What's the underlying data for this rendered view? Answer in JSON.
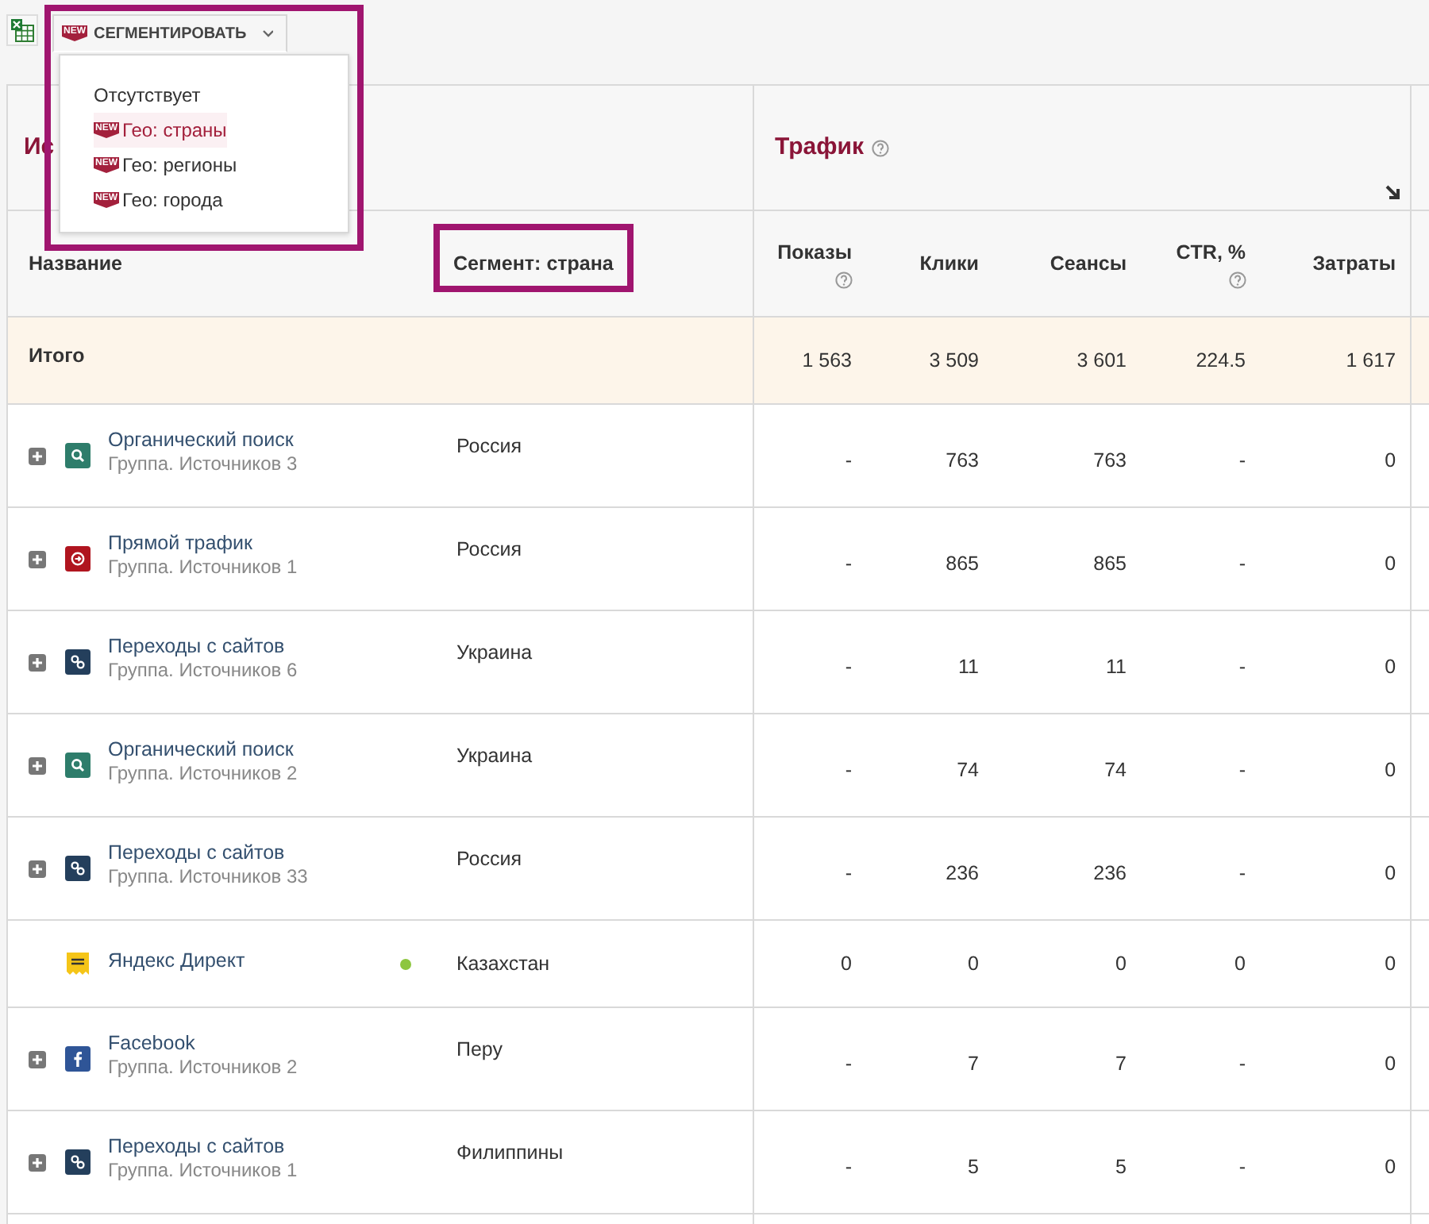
{
  "toolbar": {
    "segment_button": {
      "label": "СЕГМЕНТИРОВАТЬ",
      "new_label": "NEW",
      "expanded": true,
      "highlighted": true
    }
  },
  "segment_menu": [
    {
      "label": "Отсутствует",
      "selected": false
    },
    {
      "label": "Гео: страны",
      "new_label": "NEW",
      "selected": true
    },
    {
      "label": "Гео: регионы",
      "new_label": "NEW",
      "selected": false
    },
    {
      "label": "Гео: города",
      "new_label": "NEW",
      "selected": false
    }
  ],
  "column_groups": [
    {
      "title": "Ис"
    },
    {
      "title": "Трафик",
      "help": true
    }
  ],
  "columns": [
    {
      "label": "Название"
    },
    {
      "label": "Сегмент: страна",
      "highlighted": true
    },
    {
      "label": "Показы",
      "help": true
    },
    {
      "label": "Клики"
    },
    {
      "label": "Сеансы"
    },
    {
      "label": "CTR, %",
      "help": true
    },
    {
      "label": "Затраты"
    }
  ],
  "total": {
    "label": "Итого",
    "values": [
      "1 563",
      "3 509",
      "3 601",
      "224.5",
      "1 617"
    ]
  },
  "rows": [
    {
      "name": "Органический поиск",
      "subtitle": "Группа. Источников 3",
      "kind": "search",
      "expandable": true,
      "segment": "Россия",
      "values": [
        "-",
        "763",
        "763",
        "-",
        "0"
      ]
    },
    {
      "name": "Прямой трафик",
      "subtitle": "Группа. Источников 1",
      "kind": "direct",
      "expandable": true,
      "segment": "Россия",
      "values": [
        "-",
        "865",
        "865",
        "-",
        "0"
      ]
    },
    {
      "name": "Переходы с сайтов",
      "subtitle": "Группа. Источников 6",
      "kind": "link",
      "expandable": true,
      "segment": "Украина",
      "values": [
        "-",
        "11",
        "11",
        "-",
        "0"
      ]
    },
    {
      "name": "Органический поиск",
      "subtitle": "Группа. Источников 2",
      "kind": "search",
      "expandable": true,
      "segment": "Украина",
      "values": [
        "-",
        "74",
        "74",
        "-",
        "0"
      ]
    },
    {
      "name": "Переходы с сайтов",
      "subtitle": "Группа. Источников 33",
      "kind": "link",
      "expandable": true,
      "segment": "Россия",
      "values": [
        "-",
        "236",
        "236",
        "-",
        "0"
      ]
    },
    {
      "name": "Яндекс Директ",
      "kind": "yandex",
      "expandable": false,
      "color": "#8dc63f",
      "segment": "Казахстан",
      "values": [
        "0",
        "0",
        "0",
        "0",
        "0"
      ]
    },
    {
      "name": "Facebook",
      "subtitle": "Группа. Источников 2",
      "kind": "facebook",
      "expandable": true,
      "segment": "Перу",
      "values": [
        "-",
        "7",
        "7",
        "-",
        "0"
      ]
    },
    {
      "name": "Переходы с сайтов",
      "subtitle": "Группа. Источников 1",
      "kind": "link",
      "expandable": true,
      "segment": "Филиппины",
      "values": [
        "-",
        "5",
        "5",
        "-",
        "0"
      ]
    }
  ]
}
